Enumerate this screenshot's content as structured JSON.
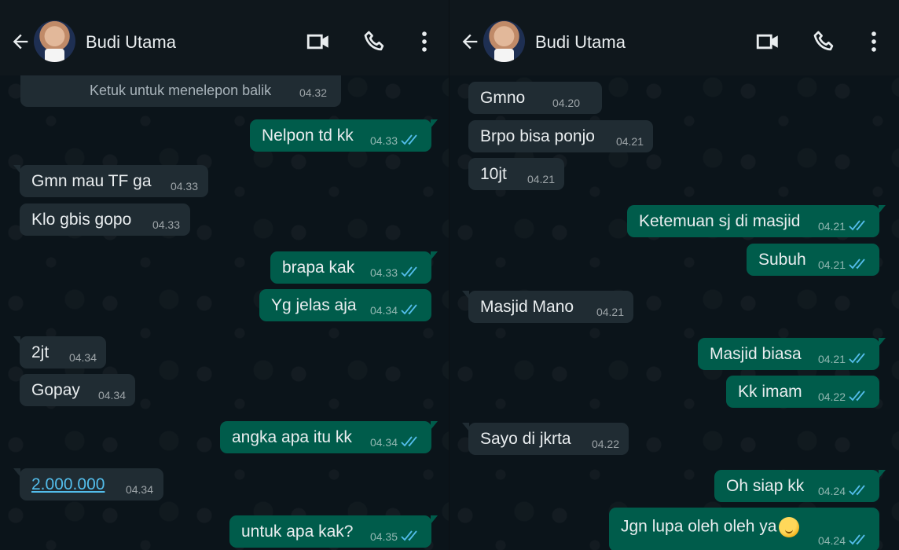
{
  "left": {
    "contact_name": "Budi Utama",
    "call_notice": {
      "text": "Ketuk untuk menelepon balik",
      "time": "04.32"
    },
    "messages": [
      {
        "dir": "out",
        "text": "Nelpon td kk",
        "time": "04.33",
        "read": true
      },
      {
        "dir": "in",
        "text": "Gmn mau TF ga",
        "time": "04.33"
      },
      {
        "dir": "in",
        "text": "Klo gbis gopo",
        "time": "04.33"
      },
      {
        "dir": "out",
        "text": "brapa kak",
        "time": "04.33",
        "read": true
      },
      {
        "dir": "out",
        "text": "Yg jelas aja",
        "time": "04.34",
        "read": true
      },
      {
        "dir": "in",
        "text": "2jt",
        "time": "04.34"
      },
      {
        "dir": "in",
        "text": "Gopay",
        "time": "04.34"
      },
      {
        "dir": "out",
        "text": "angka apa itu kk",
        "time": "04.34",
        "read": true
      },
      {
        "dir": "in",
        "text": "2.000.000",
        "time": "04.34",
        "link": true
      },
      {
        "dir": "out",
        "text": "untuk apa kak?",
        "time": "04.35",
        "read": true
      }
    ]
  },
  "right": {
    "contact_name": "Budi Utama",
    "messages": [
      {
        "dir": "in",
        "text": "Gmno",
        "time": "04.20"
      },
      {
        "dir": "in",
        "text": "Brpo bisa ponjo",
        "time": "04.21"
      },
      {
        "dir": "in",
        "text": "10jt",
        "time": "04.21"
      },
      {
        "dir": "out",
        "text": "Ketemuan sj di masjid",
        "time": "04.21",
        "read": true
      },
      {
        "dir": "out",
        "text": "Subuh",
        "time": "04.21",
        "read": true
      },
      {
        "dir": "in",
        "text": "Masjid Mano",
        "time": "04.21"
      },
      {
        "dir": "out",
        "text": "Masjid biasa",
        "time": "04.21",
        "read": true
      },
      {
        "dir": "out",
        "text": "Kk imam",
        "time": "04.22",
        "read": true
      },
      {
        "dir": "in",
        "text": "Sayo di jkrta",
        "time": "04.22"
      },
      {
        "dir": "out",
        "text": "Oh siap kk",
        "time": "04.24",
        "read": true
      },
      {
        "dir": "out",
        "text": "Jgn lupa oleh oleh ya",
        "time": "04.24",
        "read": true,
        "emoji": "hand-over-mouth-emoji"
      }
    ]
  },
  "icons": {
    "back": "arrow-left-icon",
    "video": "video-camera-icon",
    "call": "phone-icon",
    "more": "more-vertical-icon",
    "read": "double-check-icon"
  },
  "colors": {
    "background": "#0b141a",
    "header": "#0f171c",
    "incoming_bubble": "#202c33",
    "outgoing_bubble": "#005c4b",
    "read_ticks": "#53bdeb",
    "link": "#53bdeb"
  }
}
